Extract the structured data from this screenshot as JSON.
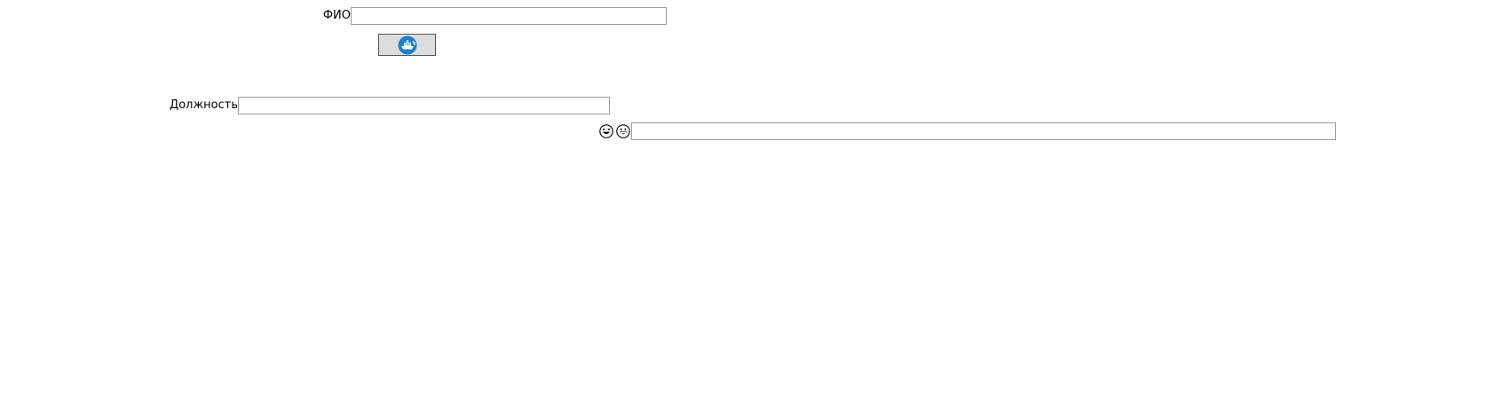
{
  "form": {
    "fio": {
      "label": "ФИО",
      "value": ""
    },
    "position": {
      "label": "Должность",
      "value": ""
    },
    "extra": {
      "value": ""
    }
  },
  "toolbar": {
    "icon": "ship-refresh-icon",
    "accent": "#1a7fd4"
  },
  "emoji_icons": [
    "laughing-face-icon",
    "grinning-face-icon"
  ]
}
